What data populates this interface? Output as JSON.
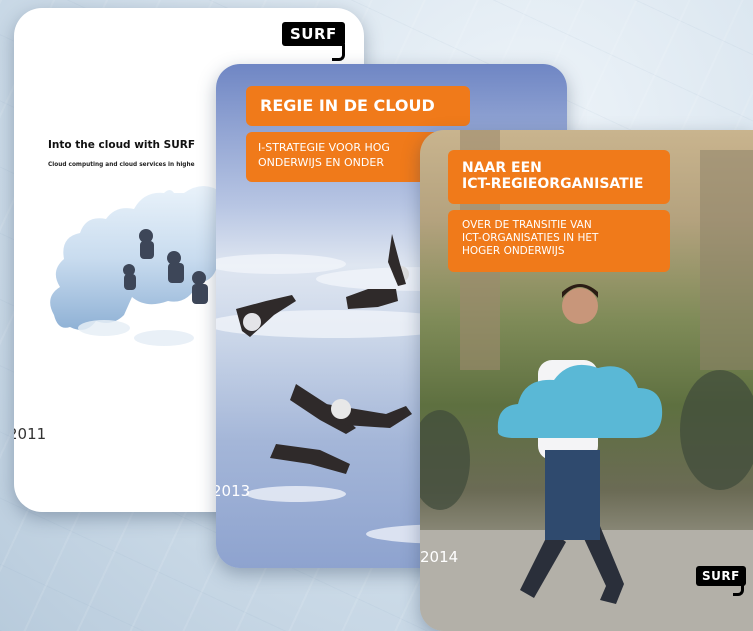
{
  "covers": [
    {
      "year": "2011",
      "logo": "SURF",
      "title": "Into the cloud with SURF",
      "subtitle": "Cloud computing and cloud services in highe"
    },
    {
      "year": "2013",
      "title": "REGIE IN DE CLOUD",
      "subtitle_lines": [
        "I-STRATEGIE VOOR HOG",
        "ONDERWIJS EN ONDER"
      ]
    },
    {
      "year": "2014",
      "logo": "SURF",
      "title_lines": [
        "NAAR EEN",
        "ICT-REGIEORGANISATIE"
      ],
      "subtitle_lines": [
        "OVER DE TRANSITIE VAN",
        "ICT-ORGANISATIES IN HET",
        "HOGER ONDERWIJS"
      ]
    }
  ],
  "colors": {
    "orange": "#f07a1a",
    "logo_black": "#000000",
    "sky_blue": "#8fa2d2",
    "cloud_icon": "#5ab8d6"
  }
}
